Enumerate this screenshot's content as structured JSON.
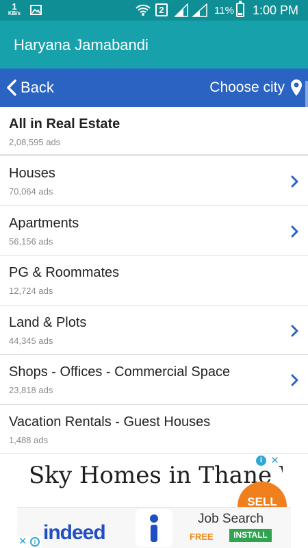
{
  "status_bar": {
    "speed_value": "1",
    "speed_unit": "KB/s",
    "sim_slot": "2",
    "battery_percent": "11%",
    "time": "1:00 PM",
    "icons": [
      "image-icon",
      "wifi-icon",
      "signal-icon",
      "signal-icon",
      "battery-icon"
    ]
  },
  "app_bar": {
    "title": "Haryana Jamabandi"
  },
  "nav": {
    "back_label": "Back",
    "city_label": "Choose city"
  },
  "list": {
    "header": {
      "title": "All in Real Estate",
      "count": "2,08,595 ads"
    },
    "items": [
      {
        "title": "Houses",
        "count": "70,064 ads",
        "has_chevron": true
      },
      {
        "title": "Apartments",
        "count": "56,156 ads",
        "has_chevron": true
      },
      {
        "title": "PG & Roommates",
        "count": "12,724 ads",
        "has_chevron": false
      },
      {
        "title": "Land & Plots",
        "count": "44,345 ads",
        "has_chevron": true
      },
      {
        "title": "Shops - Offices - Commercial Space",
        "count": "23,818 ads",
        "has_chevron": true
      },
      {
        "title": "Vacation Rentals - Guest Houses",
        "count": "1,488 ads",
        "has_chevron": false
      }
    ]
  },
  "ad_banner": {
    "text": "Sky Homes in Thane West »",
    "info": "i",
    "close": "✕"
  },
  "sell_button": {
    "label": "SELL"
  },
  "bottom_ad": {
    "brand": "indeed",
    "title": "Job Search",
    "price": "FREE",
    "install_label": "INSTALL",
    "close": "✕",
    "info": "i"
  },
  "colors": {
    "status_bar": "#0f8f95",
    "app_bar": "#17a2ab",
    "nav_bar": "#2a63c2",
    "chevron": "#2a63c2",
    "sell_button": "#f07f1e",
    "install_button": "#2ea44f"
  }
}
